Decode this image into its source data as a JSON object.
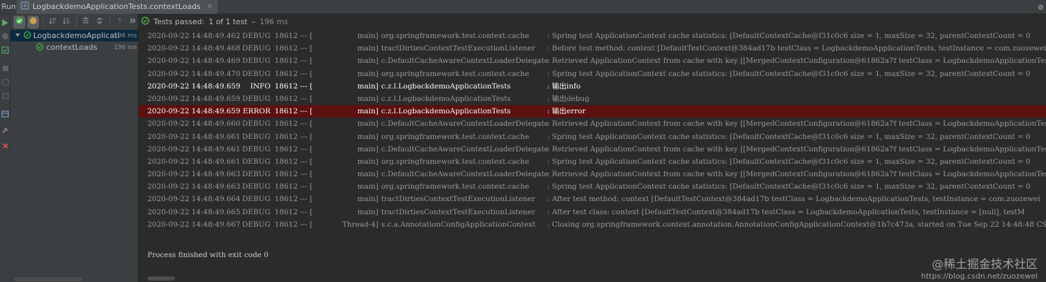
{
  "run_bar": {
    "label": "Run:",
    "tab_title": "LogbackdemoApplicationTests.contextLoads",
    "tab_close": "×",
    "settings_icon": "gear-icon"
  },
  "status": {
    "text": "Tests passed:",
    "count": "1 of 1 test",
    "separator": "–",
    "duration": "196 ms"
  },
  "tree": {
    "items": [
      {
        "label": "LogbackdemoApplicati",
        "time": "196 ms",
        "expanded": true
      },
      {
        "label": "contextLoads",
        "time": "196 ms"
      }
    ]
  },
  "colors": {
    "pass_green": "#4caf50",
    "error_bg": "#5c1010",
    "run_green": "#59a869",
    "stop_red": "#e05555"
  },
  "log_rows": [
    {
      "ts": "2020-09-22 14:48:49.462",
      "lv": "DEBUG",
      "pid": "18612 --- [",
      "th": "main]",
      "lg": "org.springframework.test.context.cache",
      "msg": ": Spring test ApplicationContext cache statistics: [DefaultContextCache@f31c0c6 size = 1, maxSize = 32, parentContextCount = 0"
    },
    {
      "ts": "2020-09-22 14:48:49.468",
      "lv": "DEBUG",
      "pid": "18612 --- [",
      "th": "main]",
      "lg": "tractDirtiesContextTestExecutionListener",
      "msg": ": Before test method: context [DefaultTestContext@384ad17b testClass = LogbackdemoApplicationTests, testInstance = com.zuozewei"
    },
    {
      "ts": "2020-09-22 14:48:49.469",
      "lv": "DEBUG",
      "pid": "18612 --- [",
      "th": "main]",
      "lg": "c.DefaultCacheAwareContextLoaderDelegate",
      "msg": ": Retrieved ApplicationContext from cache with key [[MergedContextConfiguration@61862a7f testClass = LogbackdemoApplicationTes"
    },
    {
      "ts": "2020-09-22 14:48:49.470",
      "lv": "DEBUG",
      "pid": "18612 --- [",
      "th": "main]",
      "lg": "org.springframework.test.context.cache",
      "msg": ": Spring test ApplicationContext cache statistics: [DefaultContextCache@f31c0c6 size = 1, maxSize = 32, parentContextCount = 0"
    },
    {
      "ts": "2020-09-22 14:48:49.659",
      "lv": "INFO",
      "pid": "18612 --- [",
      "th": "main]",
      "lg": "c.z.l.LogbackdemoApplicationTests",
      "msg": ": 输出info",
      "kind": "info"
    },
    {
      "ts": "2020-09-22 14:48:49.659",
      "lv": "DEBUG",
      "pid": "18612 --- [",
      "th": "main]",
      "lg": "c.z.l.LogbackdemoApplicationTests",
      "msg": ": 输出debug"
    },
    {
      "ts": "2020-09-22 14:48:49.659",
      "lv": "ERROR",
      "pid": "18612 --- [",
      "th": "main]",
      "lg": "c.z.l.LogbackdemoApplicationTests",
      "msg": ": 输出error",
      "kind": "error"
    },
    {
      "ts": "2020-09-22 14:48:49.660",
      "lv": "DEBUG",
      "pid": "18612 --- [",
      "th": "main]",
      "lg": "c.DefaultCacheAwareContextLoaderDelegate",
      "msg": ": Retrieved ApplicationContext from cache with key [[MergedContextConfiguration@61862a7f testClass = LogbackdemoApplicationTes"
    },
    {
      "ts": "2020-09-22 14:48:49.661",
      "lv": "DEBUG",
      "pid": "18612 --- [",
      "th": "main]",
      "lg": "org.springframework.test.context.cache",
      "msg": ": Spring test ApplicationContext cache statistics: [DefaultContextCache@f31c0c6 size = 1, maxSize = 32, parentContextCount = 0"
    },
    {
      "ts": "2020-09-22 14:48:49.661",
      "lv": "DEBUG",
      "pid": "18612 --- [",
      "th": "main]",
      "lg": "c.DefaultCacheAwareContextLoaderDelegate",
      "msg": ": Retrieved ApplicationContext from cache with key [[MergedContextConfiguration@61862a7f testClass = LogbackdemoApplicationTes"
    },
    {
      "ts": "2020-09-22 14:48:49.661",
      "lv": "DEBUG",
      "pid": "18612 --- [",
      "th": "main]",
      "lg": "org.springframework.test.context.cache",
      "msg": ": Spring test ApplicationContext cache statistics: [DefaultContextCache@f31c0c6 size = 1, maxSize = 32, parentContextCount = 0"
    },
    {
      "ts": "2020-09-22 14:48:49.663",
      "lv": "DEBUG",
      "pid": "18612 --- [",
      "th": "main]",
      "lg": "c.DefaultCacheAwareContextLoaderDelegate",
      "msg": ": Retrieved ApplicationContext from cache with key [[MergedContextConfiguration@61862a7f testClass = LogbackdemoApplicationTes"
    },
    {
      "ts": "2020-09-22 14:48:49.663",
      "lv": "DEBUG",
      "pid": "18612 --- [",
      "th": "main]",
      "lg": "org.springframework.test.context.cache",
      "msg": ": Spring test ApplicationContext cache statistics: [DefaultContextCache@f31c0c6 size = 1, maxSize = 32, parentContextCount = 0"
    },
    {
      "ts": "2020-09-22 14:48:49.664",
      "lv": "DEBUG",
      "pid": "18612 --- [",
      "th": "main]",
      "lg": "tractDirtiesContextTestExecutionListener",
      "msg": ": After test method: context [DefaultTestContext@384ad17b testClass = LogbackdemoApplicationTests, testInstance = com.zuozewei"
    },
    {
      "ts": "2020-09-22 14:48:49.665",
      "lv": "DEBUG",
      "pid": "18612 --- [",
      "th": "main]",
      "lg": "tractDirtiesContextTestExecutionListener",
      "msg": ": After test class: context [DefaultTestContext@384ad17b testClass = LogbackdemoApplicationTests, testInstance = [null], testM"
    },
    {
      "ts": "2020-09-22 14:48:49.667",
      "lv": "DEBUG",
      "pid": "18612 --- [",
      "th": "Thread-4]",
      "lg": "s.c.a.AnnotationConfigApplicationContext",
      "msg": ": Closing org.springframework.context.annotation.AnnotationConfigApplicationContext@1b7c473a, started on Tue Sep 22 14:48:48 CS"
    }
  ],
  "process_finished": "Process finished with exit code 0",
  "watermark": {
    "cn": "@稀土掘金技术社区",
    "url": "https://blog.csdn.net/zuozewei"
  }
}
